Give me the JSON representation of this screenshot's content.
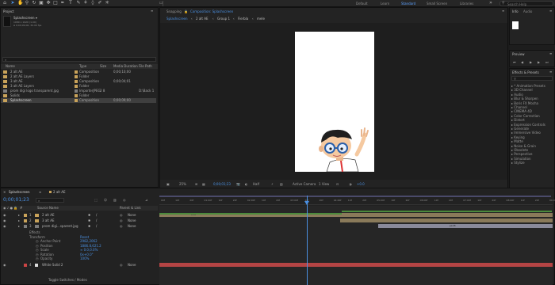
{
  "workspaces": [
    "Default",
    "Learn",
    "Standard",
    "Small Screen",
    "Libraries"
  ],
  "active_workspace": "Standard",
  "search_help": {
    "placeholder": "Search Help"
  },
  "project": {
    "title": "Project",
    "comp_name": "Splashscreen ▾",
    "comp_info": [
      "1080 x 1920 (1.00)",
      "Δ 0;00;09;00, 30.00 fps"
    ],
    "search_placeholder": "⌕",
    "columns": [
      "Name",
      "Type",
      "Size",
      "Media Duration",
      "File Path"
    ],
    "items": [
      {
        "name": "2 alt AE",
        "type": "Composition",
        "size": "",
        "dur": "0;00;10;00",
        "path": "",
        "color": "#c9a35a",
        "icon": "composition-icon"
      },
      {
        "name": "2 alt AE Layers",
        "type": "Folder",
        "size": "",
        "dur": "",
        "path": "",
        "color": "#c9a35a",
        "icon": "folder-icon"
      },
      {
        "name": "3 alt AE",
        "type": "Composition",
        "size": "",
        "dur": "0;00;04;01",
        "path": "",
        "color": "#c9a35a",
        "icon": "composition-icon"
      },
      {
        "name": "3 alt AE Layers",
        "type": "Folder",
        "size": "",
        "dur": "",
        "path": "",
        "color": "#c9a35a",
        "icon": "folder-icon"
      },
      {
        "name": "prom digi logo transparent.jpg",
        "type": "ImporterJPEG",
        "size": "2 8",
        "dur": "",
        "path": "D:\\Back 1",
        "color": "#7d7d7d",
        "icon": "image-file-icon"
      },
      {
        "name": "Solids",
        "type": "Folder",
        "size": "",
        "dur": "",
        "path": "",
        "color": "#c9a35a",
        "icon": "folder-icon"
      },
      {
        "name": "Splashscreen",
        "type": "Composition",
        "size": "",
        "dur": "0;00;09;00",
        "path": "",
        "color": "#c9a35a",
        "icon": "composition-icon"
      }
    ],
    "bpc": "8 bpc"
  },
  "comp_panel": {
    "tabs": [
      "Snapping",
      "Composition: Splashscreen"
    ],
    "flow": [
      "Splashscreen",
      "2 alt AE",
      "Group 1",
      "Fierbla",
      "mele"
    ],
    "zoom": "25%",
    "time": "0;00;01;23",
    "resolution": "Half",
    "camera": "Active Camera",
    "views": "1 View",
    "exposure": "+0.0"
  },
  "right": {
    "info_tab": "Info",
    "audio_tab": "Audio",
    "preview_tab": "Preview",
    "effects_title": "Effects & Presets",
    "effects": [
      "* Animation Presets",
      "3D Channel",
      "Audio",
      "Blur & Sharpen",
      "Boris FX Mocha",
      "Channel",
      "CINEMA 4D",
      "Color Correction",
      "Distort",
      "Expression Controls",
      "Generate",
      "Immersive Video",
      "Keying",
      "Matte",
      "Noise & Grain",
      "Obsolete",
      "Perspective",
      "Simulation",
      "Stylize"
    ]
  },
  "timeline": {
    "tabs": [
      "Splashscreen",
      "2 alt AE"
    ],
    "timecode": "0;00;01;23",
    "search_placeholder": "⌕",
    "columns": [
      "#",
      "Source Name",
      "Parent & Link"
    ],
    "ruler": [
      "00f",
      "10f",
      "20f",
      "01:00f",
      "10f",
      "20f",
      "02:00f",
      "10f",
      "20f",
      "03:00f",
      "10f",
      "20f",
      "04:00f",
      "10f",
      "20f",
      "05:00f",
      "10f",
      "20f",
      "06:00f",
      "10f",
      "20f",
      "07:00f",
      "10f",
      "20f",
      "08:00f",
      "10f",
      "20f",
      "09:0"
    ],
    "layers": [
      {
        "num": "1",
        "name": "2 alt AE",
        "parent": "None",
        "label": "#c9a35a"
      },
      {
        "num": "2",
        "name": "3 alt AE",
        "parent": "None",
        "label": "#c9a35a"
      },
      {
        "num": "3",
        "name": "prom digi...sparent.jpg",
        "parent": "None",
        "label": "#7d7d7d"
      }
    ],
    "effects_label": "Effects",
    "transform_label": "Transform",
    "reset_label": "Reset",
    "props": [
      {
        "name": "Anchor Point",
        "value": "2982,2062"
      },
      {
        "name": "Position",
        "value": "1886.8,621.2"
      },
      {
        "name": "Scale",
        "value": "∞ 0.0,0.0%"
      },
      {
        "name": "Rotation",
        "value": "0x+0.0°"
      },
      {
        "name": "Opacity",
        "value": "100%"
      }
    ],
    "solid_layer": {
      "num": "4",
      "name": "White Solid 2",
      "parent": "None",
      "label": "#c44"
    },
    "toggle_label": "Toggle Switches / Modes",
    "bar_labels": [
      "2C8",
      "pLC8"
    ]
  }
}
